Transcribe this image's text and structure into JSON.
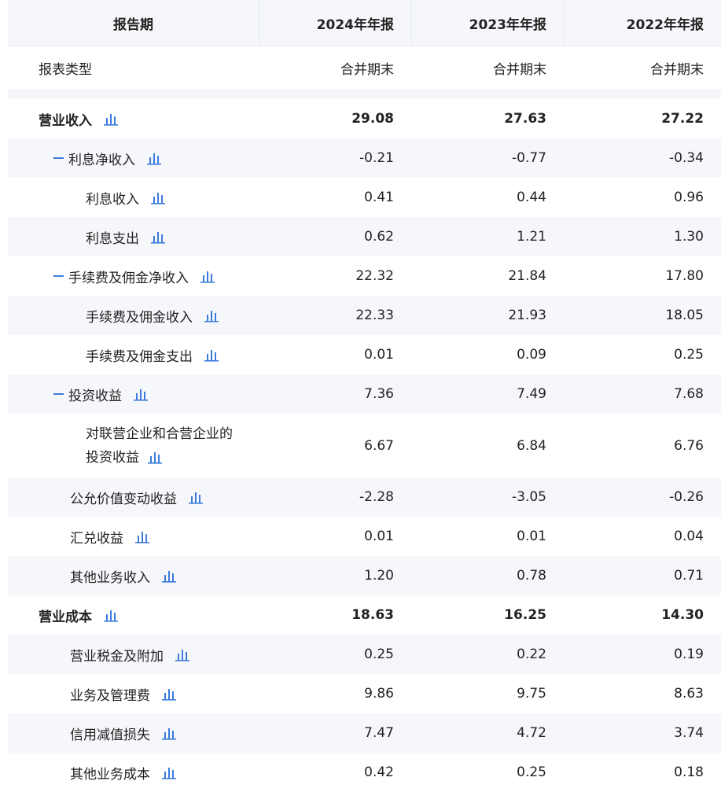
{
  "header": {
    "label_col": "报告期",
    "years": [
      "2024年年报",
      "2023年年报",
      "2022年年报"
    ]
  },
  "report_type": {
    "label": "报表类型",
    "values": [
      "合并期末",
      "合并期末",
      "合并期末"
    ]
  },
  "icon": {
    "name": "bar-chart-icon",
    "color": "#3b7be0"
  },
  "rows": [
    {
      "label": "营业收入",
      "values": [
        "29.08",
        "27.63",
        "27.22"
      ],
      "level": 0,
      "bold": true
    },
    {
      "label": "利息净收入",
      "values": [
        "-0.21",
        "-0.77",
        "-0.34"
      ],
      "level": 1,
      "collapse": true
    },
    {
      "label": "利息收入",
      "values": [
        "0.41",
        "0.44",
        "0.96"
      ],
      "level": 2
    },
    {
      "label": "利息支出",
      "values": [
        "0.62",
        "1.21",
        "1.30"
      ],
      "level": 2
    },
    {
      "label": "手续费及佣金净收入",
      "values": [
        "22.32",
        "21.84",
        "17.80"
      ],
      "level": 1,
      "collapse": true
    },
    {
      "label": "手续费及佣金收入",
      "values": [
        "22.33",
        "21.93",
        "18.05"
      ],
      "level": 2
    },
    {
      "label": "手续费及佣金支出",
      "values": [
        "0.01",
        "0.09",
        "0.25"
      ],
      "level": 2
    },
    {
      "label": "投资收益",
      "values": [
        "7.36",
        "7.49",
        "7.68"
      ],
      "level": 1,
      "collapse": true
    },
    {
      "label": "对联营企业和合营企业的投资收益",
      "values": [
        "6.67",
        "6.84",
        "6.76"
      ],
      "level": 2,
      "wrap": true
    },
    {
      "label": "公允价值变动收益",
      "values": [
        "-2.28",
        "-3.05",
        "-0.26"
      ],
      "level": 1
    },
    {
      "label": "汇兑收益",
      "values": [
        "0.01",
        "0.01",
        "0.04"
      ],
      "level": 1
    },
    {
      "label": "其他业务收入",
      "values": [
        "1.20",
        "0.78",
        "0.71"
      ],
      "level": 1
    },
    {
      "label": "营业成本",
      "values": [
        "18.63",
        "16.25",
        "14.30"
      ],
      "level": 0,
      "bold": true
    },
    {
      "label": "营业税金及附加",
      "values": [
        "0.25",
        "0.22",
        "0.19"
      ],
      "level": 1
    },
    {
      "label": "业务及管理费",
      "values": [
        "9.86",
        "9.75",
        "8.63"
      ],
      "level": 1
    },
    {
      "label": "信用减值损失",
      "values": [
        "7.47",
        "4.72",
        "3.74"
      ],
      "level": 1
    },
    {
      "label": "其他业务成本",
      "values": [
        "0.42",
        "0.25",
        "0.18"
      ],
      "level": 1
    }
  ]
}
